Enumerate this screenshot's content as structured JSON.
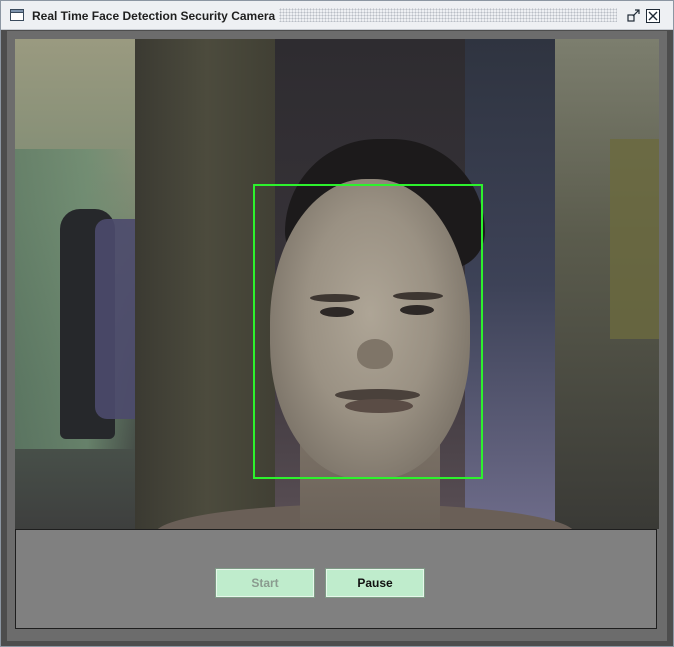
{
  "window": {
    "title": "Real Time Face Detection Security Camera",
    "title_icon": "window-icon",
    "buttons": [
      "restore-icon",
      "close-icon"
    ]
  },
  "camera": {
    "face_box_color": "#2df22d"
  },
  "controls": {
    "start_label": "Start",
    "start_enabled": false,
    "pause_label": "Pause",
    "button_color": "#bfeccc",
    "panel_color": "#808080"
  }
}
